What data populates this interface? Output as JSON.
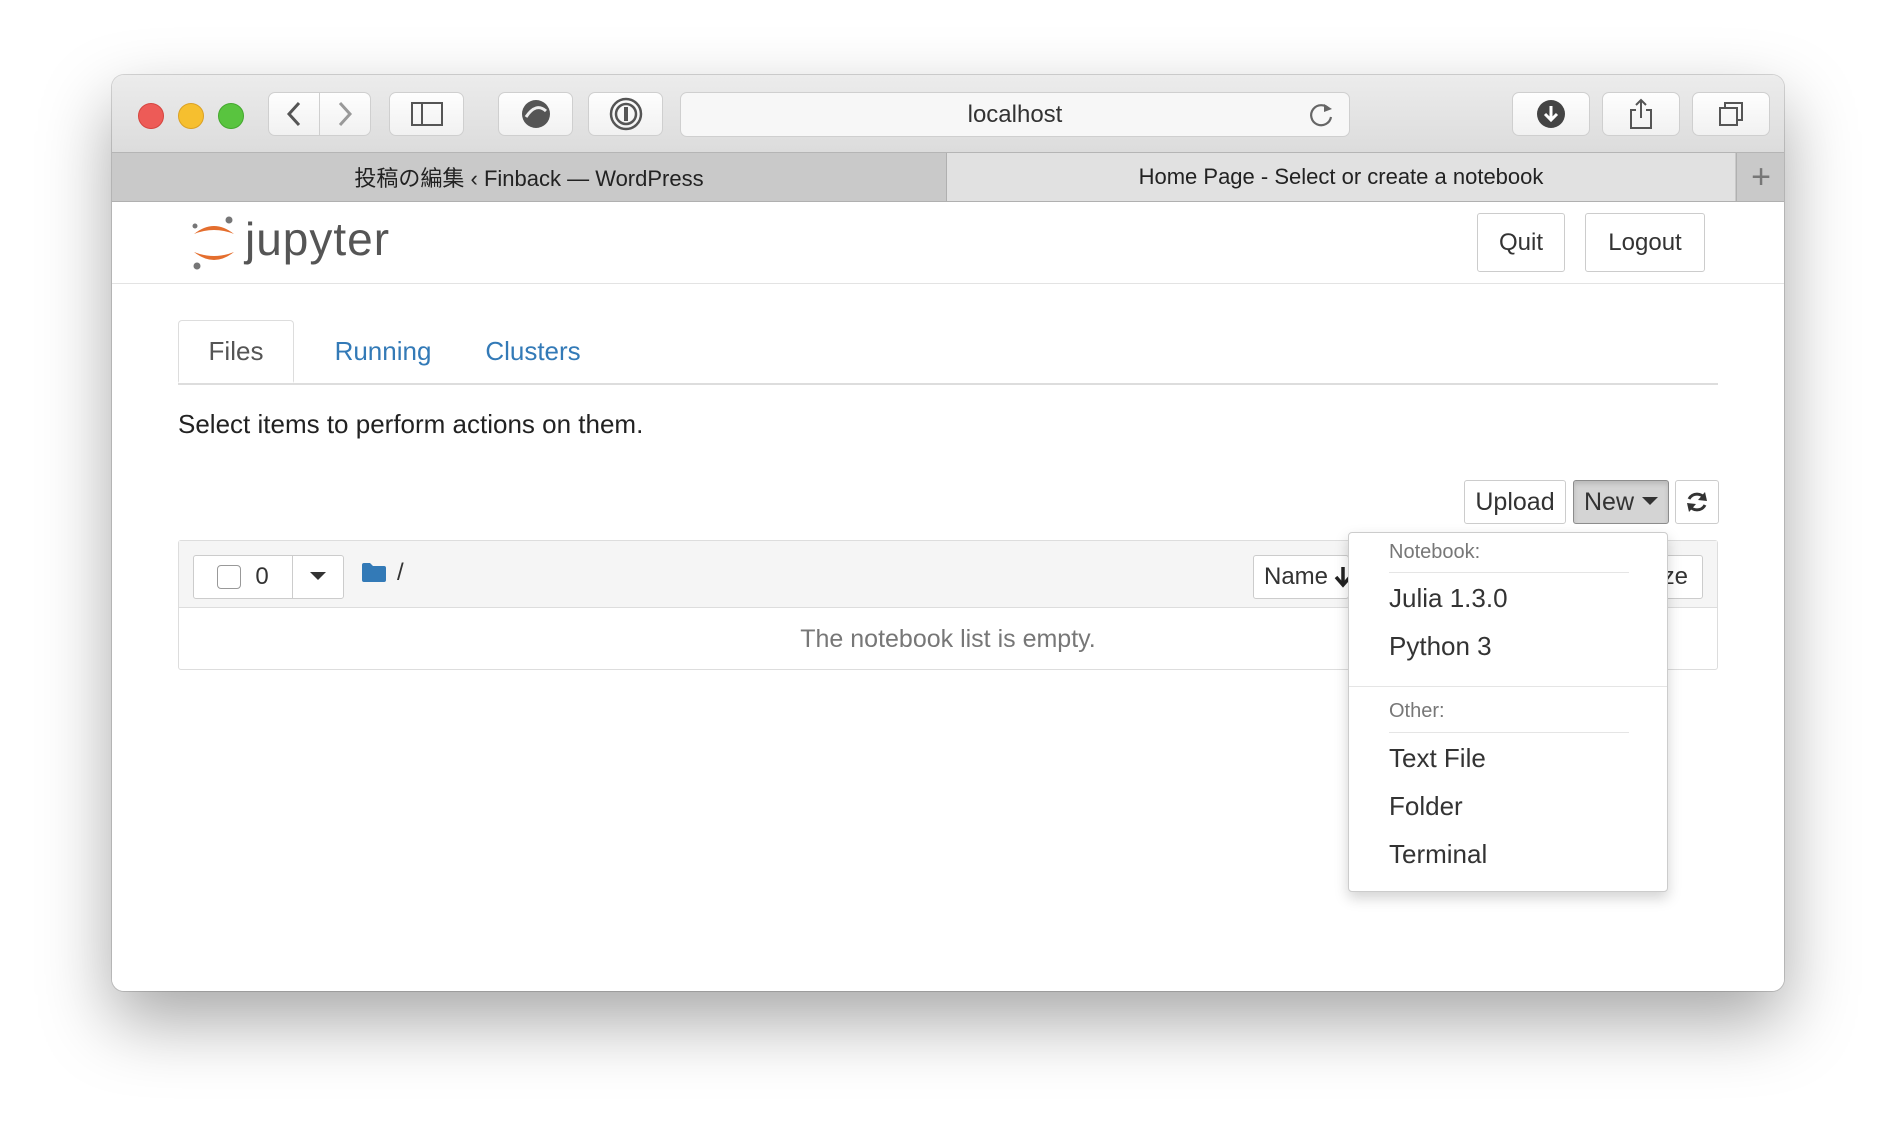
{
  "browser": {
    "url": "localhost",
    "tabs": [
      {
        "label": "投稿の編集 ‹ Finback — WordPress"
      },
      {
        "label": "Home Page - Select or create a notebook"
      }
    ],
    "new_tab_symbol": "+"
  },
  "jupyter": {
    "logo_text": "jupyter",
    "buttons": {
      "quit": "Quit",
      "logout": "Logout"
    },
    "nav_tabs": [
      {
        "label": "Files",
        "active": true
      },
      {
        "label": "Running",
        "active": false
      },
      {
        "label": "Clusters",
        "active": false
      }
    ],
    "instructions": "Select items to perform actions on them.",
    "actions": {
      "upload": "Upload",
      "new": "New"
    },
    "list": {
      "selected_count": "0",
      "path": "/",
      "sort_name": "Name",
      "size_fragment": "ze",
      "empty_message": "The notebook list is empty."
    },
    "new_menu": {
      "notebook_header": "Notebook:",
      "notebook_items": [
        "Julia 1.3.0",
        "Python 3"
      ],
      "other_header": "Other:",
      "other_items": [
        "Text File",
        "Folder",
        "Terminal"
      ]
    }
  },
  "colors": {
    "link": "#337ab7",
    "jupyter_orange": "#e46e2e",
    "traffic_red": "#ed5b57",
    "traffic_yellow": "#f6bf2f",
    "traffic_green": "#59c43f"
  },
  "icons": [
    "back-icon",
    "forward-icon",
    "sidebar-icon",
    "vpn-icon",
    "password-manager-icon",
    "reload-icon",
    "download-icon",
    "share-icon",
    "tabs-overview-icon",
    "folder-icon",
    "caret-down-icon",
    "arrow-down-icon",
    "refresh-icon"
  ]
}
